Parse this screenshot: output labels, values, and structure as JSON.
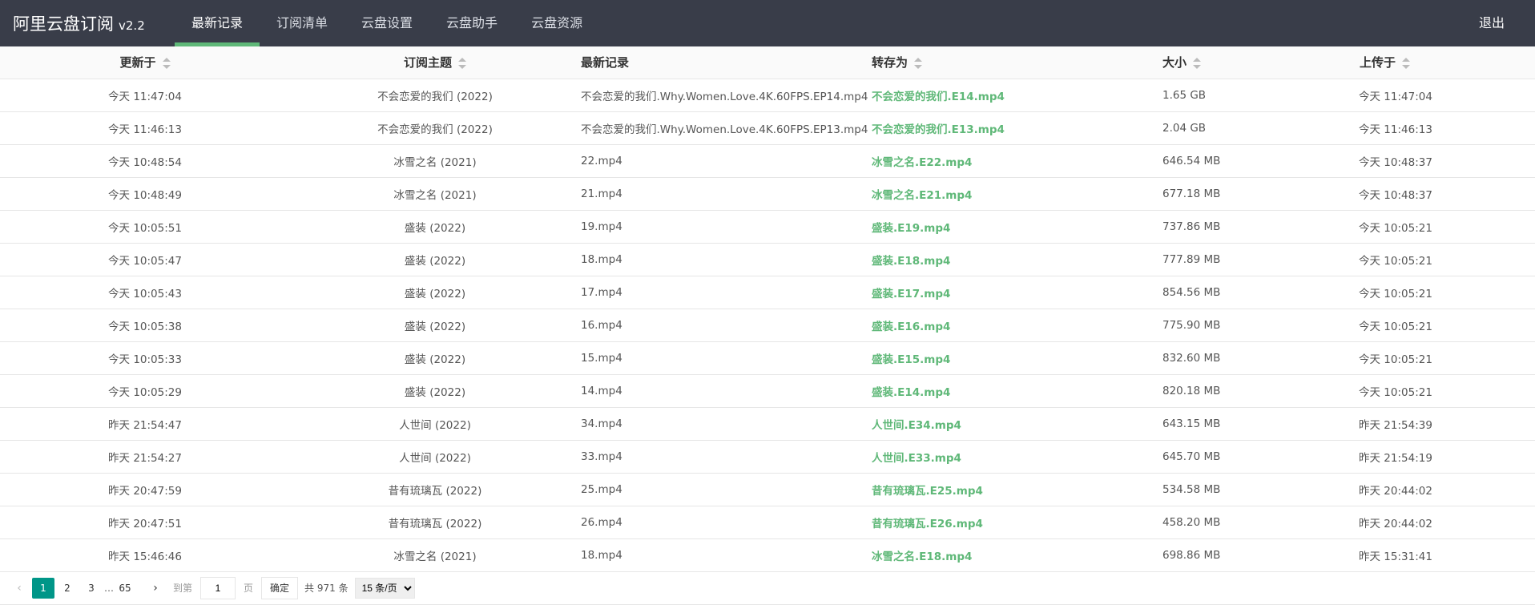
{
  "app": {
    "title": "阿里云盘订阅",
    "version": "v2.2"
  },
  "nav": [
    {
      "label": "最新记录"
    },
    {
      "label": "订阅清单"
    },
    {
      "label": "云盘设置"
    },
    {
      "label": "云盘助手"
    },
    {
      "label": "云盘资源"
    }
  ],
  "logout_label": "退出",
  "colors": {
    "topbar": "#393d49",
    "accent": "#5fb878",
    "pager_active": "#009688"
  },
  "table": {
    "headers": [
      "更新于",
      "订阅主题",
      "最新记录",
      "转存为",
      "大小",
      "上传于"
    ],
    "rows": [
      [
        "今天 11:47:04",
        "不会恋爱的我们 (2022)",
        "不会恋爱的我们.Why.Women.Love.4K.60FPS.EP14.mp4",
        "不会恋爱的我们.E14.mp4",
        "1.65 GB",
        "今天 11:47:04"
      ],
      [
        "今天 11:46:13",
        "不会恋爱的我们 (2022)",
        "不会恋爱的我们.Why.Women.Love.4K.60FPS.EP13.mp4",
        "不会恋爱的我们.E13.mp4",
        "2.04 GB",
        "今天 11:46:13"
      ],
      [
        "今天 10:48:54",
        "冰雪之名 (2021)",
        "22.mp4",
        "冰雪之名.E22.mp4",
        "646.54 MB",
        "今天 10:48:37"
      ],
      [
        "今天 10:48:49",
        "冰雪之名 (2021)",
        "21.mp4",
        "冰雪之名.E21.mp4",
        "677.18 MB",
        "今天 10:48:37"
      ],
      [
        "今天 10:05:51",
        "盛装 (2022)",
        "19.mp4",
        "盛装.E19.mp4",
        "737.86 MB",
        "今天 10:05:21"
      ],
      [
        "今天 10:05:47",
        "盛装 (2022)",
        "18.mp4",
        "盛装.E18.mp4",
        "777.89 MB",
        "今天 10:05:21"
      ],
      [
        "今天 10:05:43",
        "盛装 (2022)",
        "17.mp4",
        "盛装.E17.mp4",
        "854.56 MB",
        "今天 10:05:21"
      ],
      [
        "今天 10:05:38",
        "盛装 (2022)",
        "16.mp4",
        "盛装.E16.mp4",
        "775.90 MB",
        "今天 10:05:21"
      ],
      [
        "今天 10:05:33",
        "盛装 (2022)",
        "15.mp4",
        "盛装.E15.mp4",
        "832.60 MB",
        "今天 10:05:21"
      ],
      [
        "今天 10:05:29",
        "盛装 (2022)",
        "14.mp4",
        "盛装.E14.mp4",
        "820.18 MB",
        "今天 10:05:21"
      ],
      [
        "昨天 21:54:47",
        "人世间 (2022)",
        "34.mp4",
        "人世间.E34.mp4",
        "643.15 MB",
        "昨天 21:54:39"
      ],
      [
        "昨天 21:54:27",
        "人世间 (2022)",
        "33.mp4",
        "人世间.E33.mp4",
        "645.70 MB",
        "昨天 21:54:19"
      ],
      [
        "昨天 20:47:59",
        "昔有琉璃瓦 (2022)",
        "25.mp4",
        "昔有琉璃瓦.E25.mp4",
        "534.58 MB",
        "昨天 20:44:02"
      ],
      [
        "昨天 20:47:51",
        "昔有琉璃瓦 (2022)",
        "26.mp4",
        "昔有琉璃瓦.E26.mp4",
        "458.20 MB",
        "昨天 20:44:02"
      ],
      [
        "昨天 15:46:46",
        "冰雪之名 (2021)",
        "18.mp4",
        "冰雪之名.E18.mp4",
        "698.86 MB",
        "昨天 15:31:41"
      ]
    ]
  },
  "pager": {
    "prev": "‹",
    "pages": [
      "1",
      "2",
      "3"
    ],
    "ellipsis": "…",
    "last": "65",
    "next": "›",
    "goto_label": "到第",
    "goto_value": "1",
    "page_unit": "页",
    "confirm": "确定",
    "total": "共 971 条",
    "page_size": "15 条/页"
  }
}
